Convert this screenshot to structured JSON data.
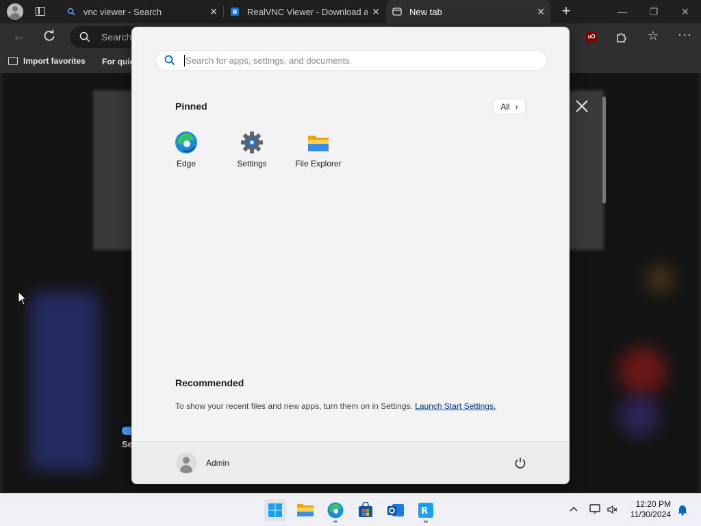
{
  "browser": {
    "tabs": [
      {
        "label": "vnc viewer - Search",
        "favicon": "search-icon"
      },
      {
        "label": "RealVNC Viewer - Download and",
        "favicon": "realvnc-icon"
      },
      {
        "label": "New tab",
        "favicon": "newtab-icon"
      }
    ],
    "address_placeholder": "Search",
    "favorites": {
      "import_label": "Import favorites",
      "quick_label": "For quic"
    },
    "peek_text": "Se"
  },
  "start_menu": {
    "search_placeholder": "Search for apps, settings, and documents",
    "pinned_title": "Pinned",
    "all_label": "All",
    "pinned_apps": [
      {
        "label": "Edge",
        "icon": "edge-icon"
      },
      {
        "label": "Settings",
        "icon": "settings-gear-icon"
      },
      {
        "label": "File Explorer",
        "icon": "folder-icon"
      }
    ],
    "recommended_title": "Recommended",
    "recommended_text": "To show your recent files and new apps, turn them on in Settings.",
    "recommended_link": "Launch Start Settings.",
    "user_name": "Admin"
  },
  "taskbar": {
    "apps": [
      "windows-start-icon",
      "file-explorer-icon",
      "edge-icon",
      "store-icon",
      "outlook-icon",
      "realvnc-viewer-icon"
    ],
    "time": "12:20 PM",
    "date": "11/30/2024"
  },
  "colors": {
    "accent": "#0067c0",
    "link": "#003e92",
    "tab_active": "#2f2f2f"
  }
}
